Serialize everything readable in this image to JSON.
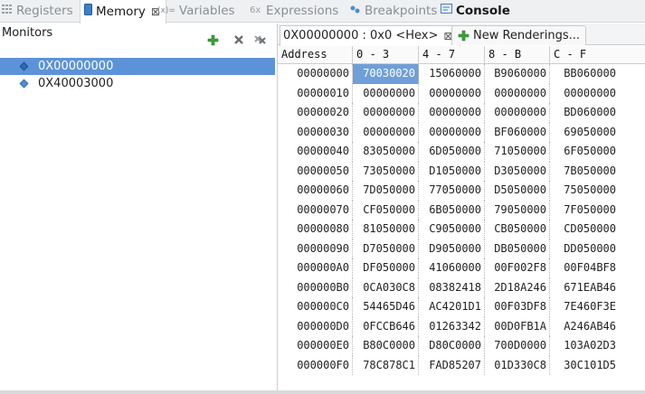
{
  "tabs": [
    {
      "label": "Registers",
      "icon": "registers-icon",
      "active": false
    },
    {
      "label": "Memory",
      "icon": "memory-icon",
      "active": true
    },
    {
      "label": "Variables",
      "icon": "variables-icon",
      "active": false
    },
    {
      "label": "Expressions",
      "icon": "expressions-icon",
      "active": false
    },
    {
      "label": "Breakpoints",
      "icon": "breakpoints-icon",
      "active": false
    },
    {
      "label": "Console",
      "icon": "console-icon",
      "active": false
    }
  ],
  "monitors": {
    "title": "Monitors",
    "items": [
      {
        "label": "0X00000000",
        "selected": true
      },
      {
        "label": "0X40003000",
        "selected": false
      }
    ]
  },
  "rendering": {
    "main_tab": "0X00000000 : 0x0 <Hex>",
    "new_tab": "New Renderings..."
  },
  "table": {
    "headers": [
      "Address",
      "0 - 3",
      "4 - 7",
      "8 - B",
      "C - F"
    ],
    "rows": [
      [
        "00000000",
        "70030020",
        "15060000",
        "B9060000",
        "BB060000"
      ],
      [
        "00000010",
        "00000000",
        "00000000",
        "00000000",
        "00000000"
      ],
      [
        "00000020",
        "00000000",
        "00000000",
        "00000000",
        "BD060000"
      ],
      [
        "00000030",
        "00000000",
        "00000000",
        "BF060000",
        "69050000"
      ],
      [
        "00000040",
        "83050000",
        "6D050000",
        "71050000",
        "6F050000"
      ],
      [
        "00000050",
        "73050000",
        "D1050000",
        "D3050000",
        "7B050000"
      ],
      [
        "00000060",
        "7D050000",
        "77050000",
        "D5050000",
        "75050000"
      ],
      [
        "00000070",
        "CF050000",
        "6B050000",
        "79050000",
        "7F050000"
      ],
      [
        "00000080",
        "81050000",
        "C9050000",
        "CB050000",
        "CD050000"
      ],
      [
        "00000090",
        "D7050000",
        "D9050000",
        "DB050000",
        "DD050000"
      ],
      [
        "000000A0",
        "DF050000",
        "41060000",
        "00F002F8",
        "00F04BF8"
      ],
      [
        "000000B0",
        "0CA030C8",
        "08382418",
        "2D18A246",
        "671EAB46"
      ],
      [
        "000000C0",
        "54465D46",
        "AC4201D1",
        "00F03DF8",
        "7E460F3E"
      ],
      [
        "000000D0",
        "0FCCB646",
        "01263342",
        "00D0FB1A",
        "A246AB46"
      ],
      [
        "000000E0",
        "B80C0000",
        "D80C0000",
        "700D0000",
        "103A02D3"
      ],
      [
        "000000F0",
        "78C878C1",
        "FAD85207",
        "01D330C8",
        "30C101D5"
      ]
    ],
    "highlighted_cell": {
      "row": 0,
      "col": 1
    }
  },
  "colors": {
    "selection": "#5c93d8",
    "cell_highlight": "#6f9fd8",
    "add_green": "#3aa23a"
  }
}
